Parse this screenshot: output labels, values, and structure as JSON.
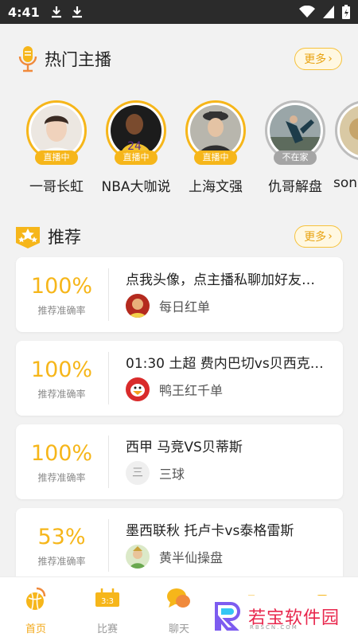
{
  "status_bar": {
    "time": "4:41"
  },
  "hot_anchors": {
    "title": "热门主播",
    "more": "更多",
    "items": [
      {
        "name": "一哥长虹",
        "status": "直播中",
        "live": true
      },
      {
        "name": "NBA大咖说",
        "status": "直播中",
        "live": true
      },
      {
        "name": "上海文强",
        "status": "直播中",
        "live": true
      },
      {
        "name": "仇哥解盘",
        "status": "不在家",
        "live": false
      },
      {
        "name": "son",
        "status": "",
        "live": false
      }
    ]
  },
  "recommend": {
    "title": "推荐",
    "more": "更多",
    "rate_label": "推荐准确率",
    "cards": [
      {
        "rate": "100%",
        "title": "点我头像，点主播私聊加好友…",
        "author": "每日红单"
      },
      {
        "rate": "100%",
        "title": "01:30 土超 费内巴切vs贝西克…",
        "author": "鸭王红千单"
      },
      {
        "rate": "100%",
        "title": "西甲 马竞VS贝蒂斯",
        "author": "三球",
        "author_initial": "三"
      },
      {
        "rate": "53%",
        "title": "墨西联秋 托卢卡vs泰格雷斯",
        "author": "黄半仙操盘"
      }
    ]
  },
  "tabbar": {
    "items": [
      {
        "label": "首页",
        "active": true
      },
      {
        "label": "比赛",
        "active": false
      },
      {
        "label": "聊天",
        "active": false
      }
    ]
  },
  "watermark": {
    "text": "若宝软件园",
    "sub": "RBSCN.COM"
  },
  "colors": {
    "accent": "#f6b61a",
    "accent_text": "#e8a312",
    "offline": "#a5a5a5"
  }
}
